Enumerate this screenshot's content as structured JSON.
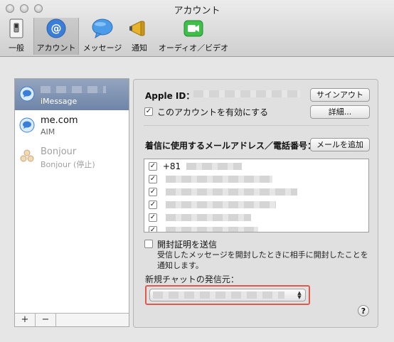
{
  "window": {
    "title": "アカウント"
  },
  "toolbar": {
    "items": [
      {
        "label": "一般",
        "icon": "switch-icon"
      },
      {
        "label": "アカウント",
        "icon": "at-sign-icon",
        "selected": true
      },
      {
        "label": "メッセージ",
        "icon": "speech-bubble-icon"
      },
      {
        "label": "通知",
        "icon": "megaphone-icon"
      },
      {
        "label": "オーディオ／ビデオ",
        "icon": "video-camera-icon"
      }
    ]
  },
  "sidebar": {
    "accounts": [
      {
        "name": "",
        "type": "iMessage",
        "selected": true,
        "enabled": true
      },
      {
        "name": "me.com",
        "type": "AIM",
        "selected": false,
        "enabled": true
      },
      {
        "name": "Bonjour",
        "type": "Bonjour (停止)",
        "selected": false,
        "enabled": false
      }
    ],
    "add_label": "+",
    "remove_label": "−"
  },
  "account": {
    "apple_id_label": "Apple ID：",
    "sign_out_label": "サインアウト",
    "enable_label": "このアカウントを有効にする",
    "enable_checked": true,
    "details_label": "詳細..."
  },
  "addresses": {
    "header": "着信に使用するメールアドレス／電話番号：",
    "add_email_label": "メールを追加",
    "items": [
      {
        "text": "+81",
        "checked": true
      },
      {
        "text": "",
        "checked": true
      },
      {
        "text": "",
        "checked": true
      },
      {
        "text": "",
        "checked": true
      },
      {
        "text": "",
        "checked": true
      },
      {
        "text": "",
        "checked": true
      }
    ]
  },
  "read_receipts": {
    "label": "開封証明を送信",
    "checked": false,
    "description_line1": "受信したメッセージを開封したときに相手に開封したことを",
    "description_line2": "通知します。"
  },
  "new_chat": {
    "label": "新規チャットの発信元：",
    "value": ""
  },
  "help_label": "?",
  "colors": {
    "highlight": "#e0594f",
    "selection": "#7b8fb0",
    "accent": "#3b7ed8"
  }
}
